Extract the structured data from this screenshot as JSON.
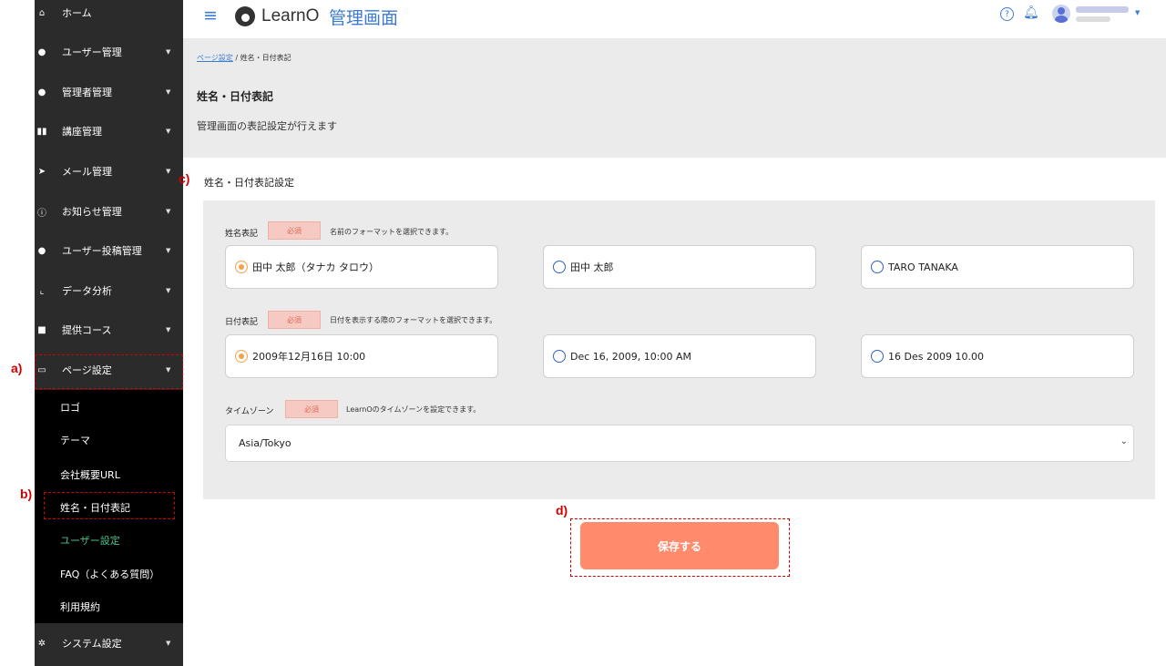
{
  "header": {
    "logo_text": "LearnO",
    "admin_title": "管理画面"
  },
  "sidebar": {
    "items": [
      {
        "label": "ホーム",
        "icon": "home-icon"
      },
      {
        "label": "ユーザー管理",
        "icon": "user-icon"
      },
      {
        "label": "管理者管理",
        "icon": "admin-icon"
      },
      {
        "label": "講座管理",
        "icon": "book-icon"
      },
      {
        "label": "メール管理",
        "icon": "paper-plane-icon"
      },
      {
        "label": "お知らせ管理",
        "icon": "info-icon"
      },
      {
        "label": "ユーザー投稿管理",
        "icon": "comments-icon"
      },
      {
        "label": "データ分析",
        "icon": "chart-icon"
      },
      {
        "label": "提供コース",
        "icon": "gift-icon"
      },
      {
        "label": "ページ設定",
        "icon": "monitor-icon"
      }
    ],
    "submenu": [
      "ロゴ",
      "テーマ",
      "会社概要URL",
      "姓名・日付表記",
      "ユーザー設定",
      "FAQ（よくある質問）",
      "利用規約"
    ],
    "system_settings": "システム設定"
  },
  "annotations": {
    "a": "a)",
    "b": "b)",
    "c": "c)",
    "d": "d)"
  },
  "breadcrumb": {
    "parent": "ページ設定",
    "separator": "/",
    "current": "姓名・日付表記"
  },
  "page": {
    "title": "姓名・日付表記",
    "description": "管理画面の表記設定が行えます"
  },
  "section": {
    "title": "姓名・日付表記設定"
  },
  "required_label": "必須",
  "name_format": {
    "label": "姓名表記",
    "hint": "名前のフォーマットを選択できます。",
    "options": [
      "田中 太郎（タナカ タロウ）",
      "田中 太郎",
      "TARO TANAKA"
    ],
    "selected": 0
  },
  "date_format": {
    "label": "日付表記",
    "hint": "日付を表示する際のフォーマットを選択できます。",
    "options": [
      "2009年12月16日 10:00",
      "Dec 16, 2009, 10:00 AM",
      "16 Des 2009 10.00"
    ],
    "selected": 0
  },
  "timezone": {
    "label": "タイムゾーン",
    "hint": "LearnOのタイムゾーンを設定できます。",
    "value": "Asia/Tokyo"
  },
  "save_button": "保存する",
  "colors": {
    "accent": "#3c7bd3",
    "save": "#ff8a6c",
    "sidebar": "#2b2b2b",
    "active": "#4cc38a",
    "annotation": "#d40000"
  }
}
